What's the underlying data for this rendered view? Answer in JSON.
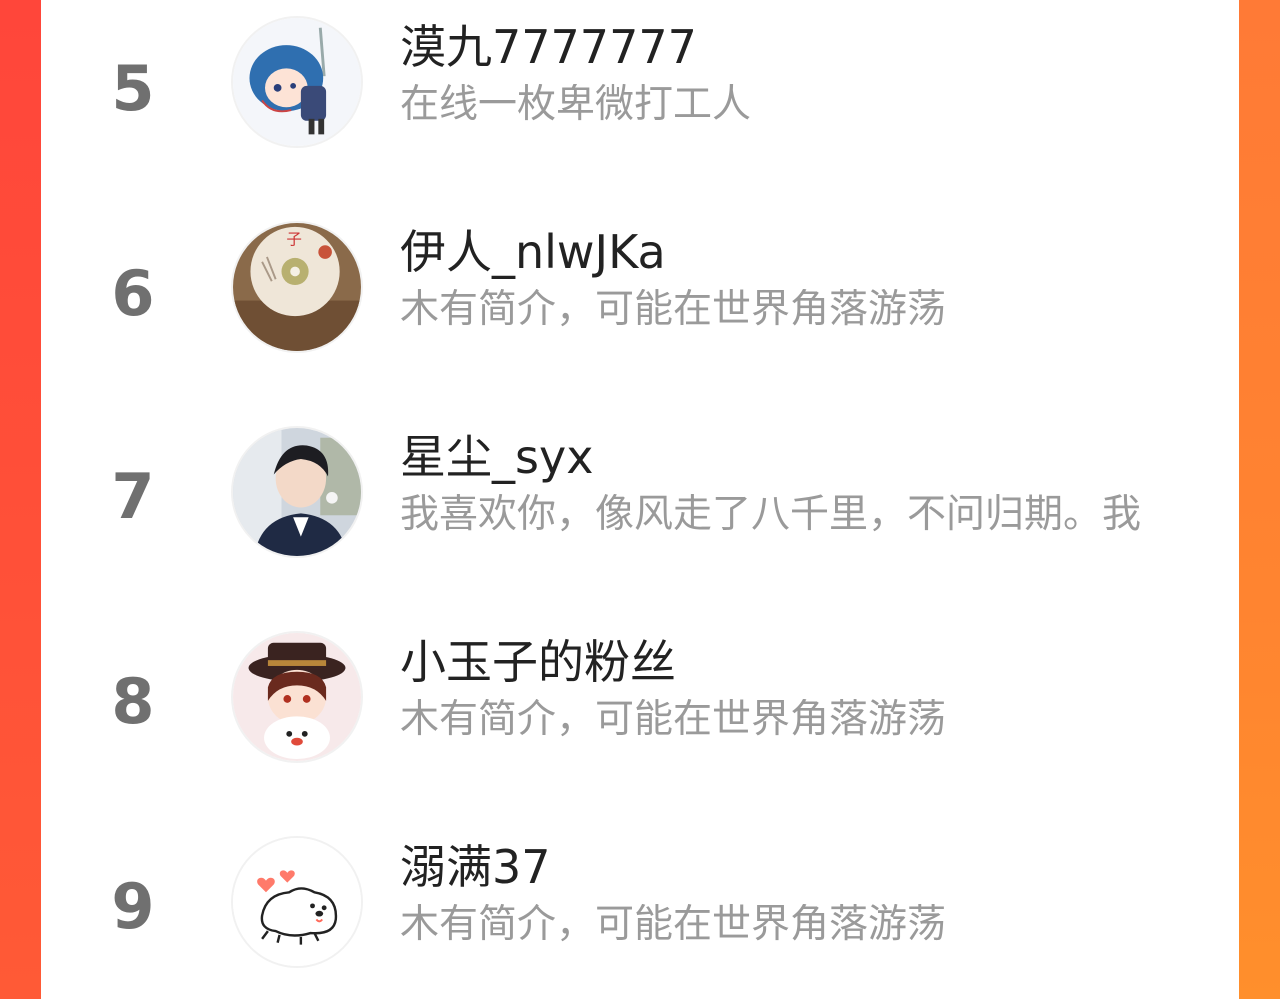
{
  "ranking": {
    "items": [
      {
        "rank": "5",
        "name": "漠九7777777",
        "bio": "在线一枚卑微打工人",
        "avatar": "anime-girl-avatar"
      },
      {
        "rank": "6",
        "name": "伊人_nlwJKa",
        "bio": "木有简介，可能在世界角落游荡",
        "avatar": "disc-photo-avatar"
      },
      {
        "rank": "7",
        "name": "星尘_syx",
        "bio": "我喜欢你，像风走了八千里，不问归期。我",
        "avatar": "person-photo-avatar"
      },
      {
        "rank": "8",
        "name": "小玉子的粉丝",
        "bio": "木有简介，可能在世界角落游荡",
        "avatar": "anime-hat-girl-avatar"
      },
      {
        "rank": "9",
        "name": "溺满37",
        "bio": "木有简介，可能在世界角落游荡",
        "avatar": "cartoon-dog-avatar"
      }
    ]
  },
  "colors": {
    "rank": "#707070",
    "name": "#222222",
    "bio": "#9a9a9a",
    "accent_left": "#ff4a3c",
    "accent_right": "#ff8a2e"
  }
}
